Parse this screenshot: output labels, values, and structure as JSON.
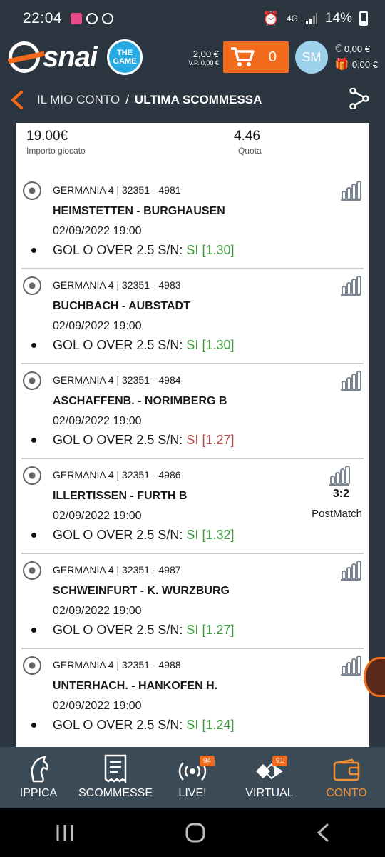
{
  "status": {
    "time": "22:04",
    "network": "4G",
    "battery": "14%"
  },
  "header": {
    "logo": "snai",
    "thegame_line1": "THE",
    "thegame_line2": "GAME",
    "balance": "2,00 €",
    "vp": "V.P. 0,00 €",
    "cart_count": "0",
    "avatar": "SM",
    "wallet_euro": "0,00 €",
    "wallet_bonus": "0,00 €"
  },
  "breadcrumb": {
    "parent": "IL MIO CONTO",
    "separator": "/",
    "current": "ULTIMA SCOMMESSA"
  },
  "summary": {
    "amount": "19.00€",
    "amount_label": "Importo giocato",
    "quota": "4.46",
    "quota_label": "Quota"
  },
  "bets": [
    {
      "league": "GERMANIA 4 | 32351 - 4981",
      "teams": "HEIMSTETTEN - BURGHAUSEN",
      "date": "02/09/2022 19:00",
      "market": "GOL O OVER 2.5 S/N:",
      "outcome": "SI",
      "odds": "[1.30]",
      "status_color": "#3b9a3b"
    },
    {
      "league": "GERMANIA 4 | 32351 - 4983",
      "teams": "BUCHBACH - AUBSTADT",
      "date": "02/09/2022 19:00",
      "market": "GOL O OVER 2.5 S/N:",
      "outcome": "SI",
      "odds": "[1.30]",
      "status_color": "#3b9a3b"
    },
    {
      "league": "GERMANIA 4 | 32351 - 4984",
      "teams": "ASCHAFFENB. - NORIMBERG B",
      "date": "02/09/2022 19:00",
      "market": "GOL O OVER 2.5 S/N:",
      "outcome": "SI",
      "odds": "[1.27]",
      "status_color": "#b34a45"
    },
    {
      "league": "GERMANIA 4 | 32351 - 4986",
      "teams": "ILLERTISSEN - FURTH B",
      "date": "02/09/2022 19:00",
      "market": "GOL O OVER 2.5 S/N:",
      "outcome": "SI",
      "odds": "[1.32]",
      "status_color": "#3b9a3b",
      "score": "3:2",
      "score_label": "PostMatch"
    },
    {
      "league": "GERMANIA 4 | 32351 - 4987",
      "teams": "SCHWEINFURT - K. WURZBURG",
      "date": "02/09/2022 19:00",
      "market": "GOL O OVER 2.5 S/N:",
      "outcome": "SI",
      "odds": "[1.27]",
      "status_color": "#3b9a3b"
    },
    {
      "league": "GERMANIA 4 | 32351 - 4988",
      "teams": "UNTERHACH. - HANKOFEN H.",
      "date": "02/09/2022 19:00",
      "market": "GOL O OVER 2.5 S/N:",
      "outcome": "SI",
      "odds": "[1.24]",
      "status_color": "#3b9a3b"
    }
  ],
  "nav": {
    "ippica": "IPPICA",
    "scommesse": "SCOMMESSE",
    "live": "LIVE!",
    "live_badge": "94",
    "virtual": "VIRTUAL",
    "virtual_badge": "91",
    "conto": "CONTO"
  },
  "colors": {
    "accent": "#f26b1d",
    "header_bg": "#2b3640",
    "nav_bg": "#3a4a57",
    "active_nav": "#f2913a",
    "win": "#3b9a3b",
    "loss": "#b34a45"
  }
}
